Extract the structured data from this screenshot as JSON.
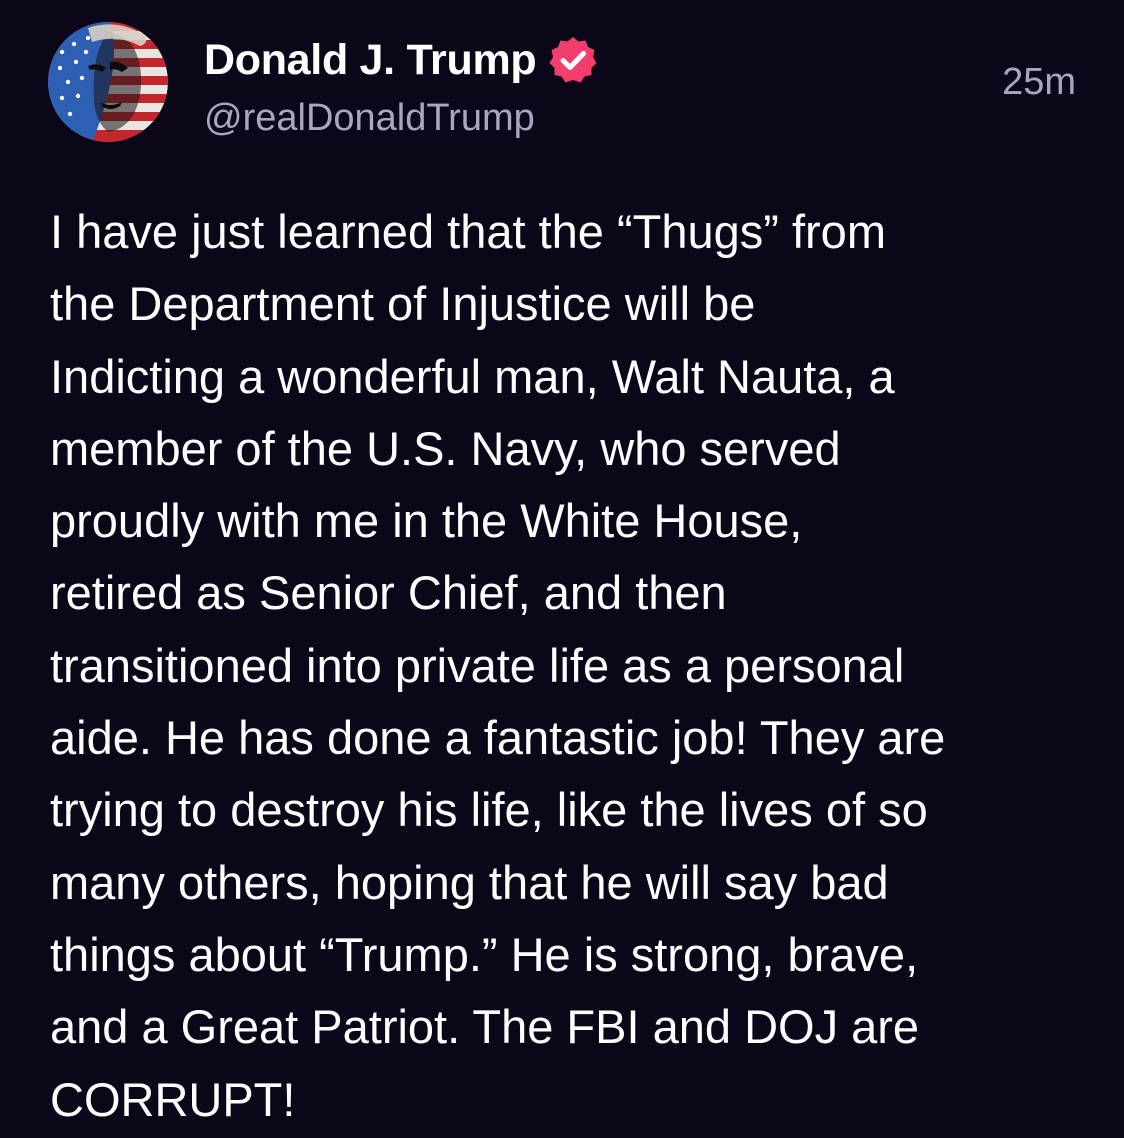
{
  "post": {
    "author": {
      "display_name": "Donald J. Trump",
      "handle": "@realDonaldTrump",
      "verified": true,
      "avatar_icon": "flag-portrait-avatar",
      "verified_icon": "verified-badge-icon",
      "verified_color": "#f23e6c"
    },
    "timestamp": "25m",
    "body_lines": [
      "I have just learned that the “Thugs” from",
      "the Department of Injustice will be",
      "Indicting a wonderful man, Walt Nauta, a",
      "member of the U.S. Navy, who served",
      "proudly with me in the White House,",
      "retired as Senior Chief, and then",
      "transitioned into private life as a personal",
      "aide. He has done a fantastic job! They are",
      "trying to destroy his life, like the lives of so",
      "many others, hoping that he will say bad",
      "things about “Trump.” He is strong, brave,",
      "and a Great Patriot. The FBI and DOJ are",
      "CORRUPT!"
    ]
  },
  "colors": {
    "background": "#0b0719",
    "primary_text": "#ffffff",
    "secondary_text": "#aaa6bd",
    "verified_badge": "#f23e6c"
  }
}
